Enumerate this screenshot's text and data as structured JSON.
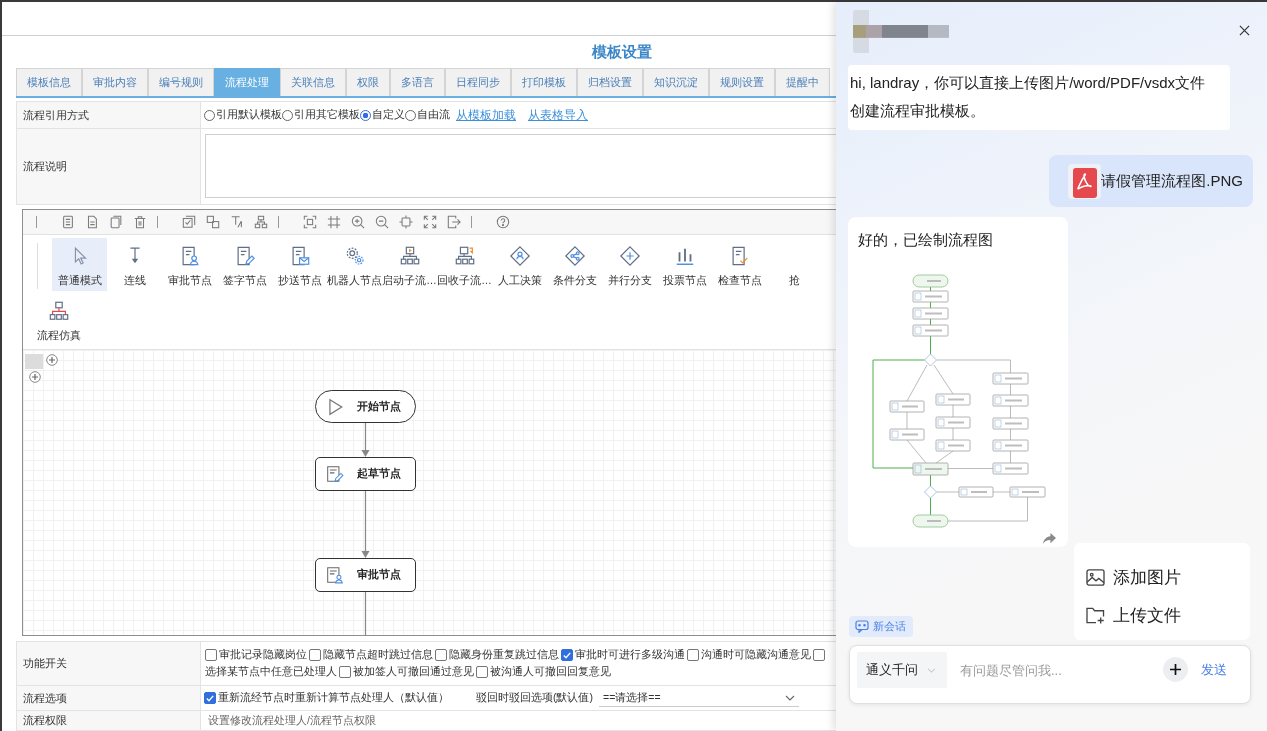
{
  "page": {
    "title": "模板设置"
  },
  "tabs": [
    {
      "label": "模板信息",
      "selected": false
    },
    {
      "label": "审批内容",
      "selected": false
    },
    {
      "label": "编号规则",
      "selected": false
    },
    {
      "label": "流程处理",
      "selected": true
    },
    {
      "label": "关联信息",
      "selected": false
    },
    {
      "label": "权限",
      "selected": false
    },
    {
      "label": "多语言",
      "selected": false
    },
    {
      "label": "日程同步",
      "selected": false
    },
    {
      "label": "打印模板",
      "selected": false
    },
    {
      "label": "归档设置",
      "selected": false
    },
    {
      "label": "知识沉淀",
      "selected": false
    },
    {
      "label": "规则设置",
      "selected": false
    },
    {
      "label": "提醒中",
      "selected": false
    }
  ],
  "form": {
    "reference": {
      "label": "流程引用方式",
      "options": [
        {
          "label": "引用默认模板",
          "selected": false
        },
        {
          "label": "引用其它模板",
          "selected": false
        },
        {
          "label": "自定义",
          "selected": true
        },
        {
          "label": "自由流",
          "selected": false
        }
      ],
      "links": [
        "从模板加载",
        "从表格导入"
      ]
    },
    "description": {
      "label": "流程说明"
    }
  },
  "designer": {
    "palette": [
      {
        "label": "普通模式",
        "selected": true
      },
      {
        "label": "连线",
        "selected": false
      },
      {
        "label": "审批节点",
        "selected": false
      },
      {
        "label": "签字节点",
        "selected": false
      },
      {
        "label": "抄送节点",
        "selected": false
      },
      {
        "label": "机器人节点",
        "selected": false
      },
      {
        "label": "启动子流…",
        "selected": false
      },
      {
        "label": "回收子流…",
        "selected": false
      },
      {
        "label": "人工决策",
        "selected": false
      },
      {
        "label": "条件分支",
        "selected": false
      },
      {
        "label": "并行分支",
        "selected": false
      },
      {
        "label": "投票节点",
        "selected": false
      },
      {
        "label": "检查节点",
        "selected": false
      },
      {
        "label": "抢",
        "selected": false
      },
      {
        "label": "流程仿真",
        "selected": false
      }
    ],
    "nodes": [
      {
        "kind": "start",
        "label": "开始节点"
      },
      {
        "kind": "draft",
        "label": "起草节点"
      },
      {
        "kind": "approval",
        "label": "审批节点"
      }
    ]
  },
  "settings": {
    "switches": {
      "label": "功能开关",
      "lines": [
        [
          {
            "kind": "checkbox",
            "label": "审批记录隐藏岗位",
            "checked": false
          },
          {
            "kind": "checkbox",
            "label": "隐藏节点超时跳过信息",
            "checked": false
          },
          {
            "kind": "checkbox",
            "label": "隐藏身份重复跳过信息",
            "checked": false
          },
          {
            "kind": "checkbox",
            "label": "审批时可进行多级沟通",
            "checked": true
          },
          {
            "kind": "checkbox",
            "label": "沟通时可隐藏沟通意见",
            "checked": false
          },
          {
            "kind": "checkbox",
            "checked": false
          }
        ],
        [
          {
            "kind": "text",
            "label": "选择某节点中任意已处理人"
          },
          {
            "kind": "checkbox",
            "label": "被加签人可撤回通过意见",
            "checked": false
          },
          {
            "kind": "checkbox",
            "label": "被沟通人可撤回回复意见",
            "checked": false
          }
        ]
      ]
    },
    "options": {
      "label": "流程选项",
      "recalculate": {
        "label": "重新流经节点时重新计算节点处理人（默认值）",
        "checked": true
      },
      "reject_label": "驳回时驳回选项(默认值)",
      "reject_select": "==请选择=="
    },
    "permissions": {
      "label": "流程权限",
      "text": "设置修改流程处理人/流程节点权限"
    }
  },
  "assistant": {
    "messages": [
      {
        "kind": "bot",
        "text": "hi, landray，你可以直接上传图片/word/PDF/vsdx文件创建流程审批模板。"
      },
      {
        "kind": "file",
        "text": "请假管理流程图.PNG"
      },
      {
        "kind": "flowchart",
        "text": "好的，已绘制流程图"
      }
    ],
    "attach_menu": [
      "添加图片",
      "上传文件"
    ],
    "new_chat": "新会话",
    "composer": {
      "model": "通义千问",
      "placeholder": "有问题尽管问我...",
      "send": "发送"
    }
  }
}
